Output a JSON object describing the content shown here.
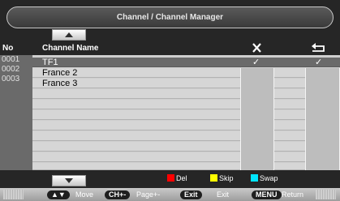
{
  "title": "Channel / Channel Manager",
  "columns": {
    "no": "No",
    "name": "Channel Name",
    "delete_icon": "x-icon",
    "skip_icon": "return-arrow-icon"
  },
  "channels": [
    {
      "no": "0001",
      "name": "TF1",
      "delete": true,
      "skip": true,
      "selected": true
    },
    {
      "no": "0002",
      "name": "France 2",
      "delete": false,
      "skip": false,
      "selected": false
    },
    {
      "no": "0003",
      "name": "France 3",
      "delete": false,
      "skip": false,
      "selected": false
    }
  ],
  "marks": {
    "check": "✓"
  },
  "legend": [
    {
      "label": "Del",
      "color": "#ff0000"
    },
    {
      "label": "Skip",
      "color": "#ffff00"
    },
    {
      "label": "Swap",
      "color": "#00e5ff"
    }
  ],
  "help": [
    {
      "key": "▲▼",
      "label": "Move"
    },
    {
      "key": "CH+-",
      "label": "Page+-"
    },
    {
      "key": "Exit",
      "label": "Exit"
    },
    {
      "key": "MENU",
      "label": "Return"
    }
  ]
}
